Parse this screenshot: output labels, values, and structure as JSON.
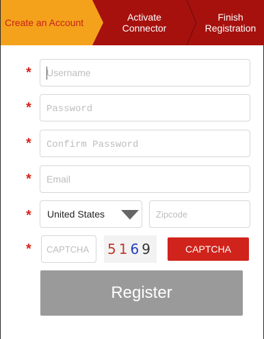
{
  "steps": [
    {
      "label": "Create an Account",
      "active": true
    },
    {
      "label_line1": "Activate",
      "label_line2": "Connector",
      "active": false
    },
    {
      "label_line1": "Finish",
      "label_line2": "Registration",
      "active": false
    }
  ],
  "form": {
    "required_marker": "*",
    "username": {
      "placeholder": "Username",
      "value": ""
    },
    "password": {
      "placeholder": "Password",
      "value": ""
    },
    "confirm_password": {
      "placeholder": "Confirm Password",
      "value": ""
    },
    "email": {
      "placeholder": "Email",
      "value": ""
    },
    "country": {
      "selected": "United States"
    },
    "zipcode": {
      "placeholder": "Zipcode",
      "value": ""
    },
    "captcha_input": {
      "placeholder": "CAPTCHA",
      "value": ""
    },
    "captcha_code": [
      {
        "digit": "5",
        "color": "#c0392b"
      },
      {
        "digit": "1",
        "color": "#c0392b"
      },
      {
        "digit": "6",
        "color": "#1f3fbf"
      },
      {
        "digit": "9",
        "color": "#333333"
      }
    ],
    "captcha_button_label": "CAPTCHA"
  },
  "register_label": "Register",
  "colors": {
    "active_step_bg": "#f4a21b",
    "steps_bg": "#a6110e",
    "accent_red": "#d0231b",
    "register_bg": "#9a9a9a"
  }
}
